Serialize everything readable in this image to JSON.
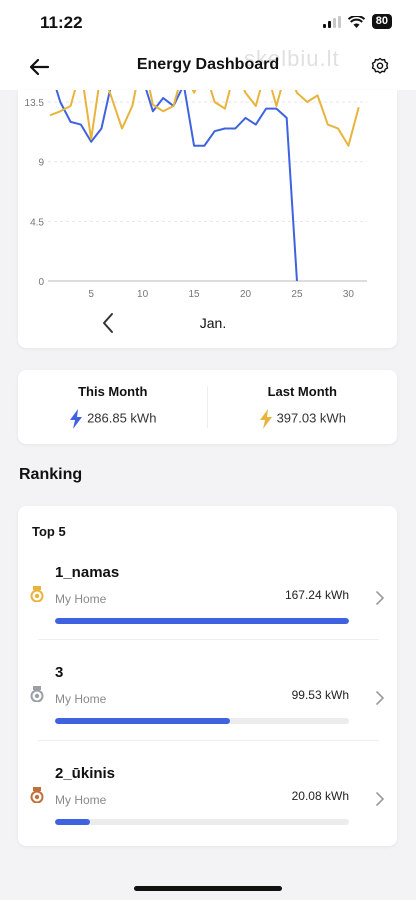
{
  "status": {
    "time": "11:22",
    "battery": "80"
  },
  "header": {
    "title": "Energy Dashboard",
    "watermark": "skelbiu.lt"
  },
  "chart_data": {
    "type": "line",
    "x": [
      1,
      2,
      3,
      4,
      5,
      6,
      7,
      8,
      9,
      10,
      11,
      12,
      13,
      14,
      15,
      16,
      17,
      18,
      19,
      20,
      21,
      22,
      23,
      24,
      25,
      26,
      27,
      28,
      29,
      30,
      31
    ],
    "series": [
      {
        "color": "#3f63e0",
        "values": [
          16,
          13.5,
          12,
          11.8,
          10.5,
          11.5,
          15,
          16,
          15.5,
          15.3,
          12.8,
          13.8,
          13.2,
          14.8,
          10.2,
          10.2,
          11.3,
          11.5,
          11.5,
          12.3,
          11.8,
          13,
          13,
          12.3,
          0
        ]
      },
      {
        "color": "#e8b43c",
        "values": [
          12.5,
          12.8,
          13.2,
          16,
          10.7,
          16,
          13.8,
          11.5,
          13.2,
          17,
          13.3,
          12.8,
          13.2,
          16,
          14.2,
          16,
          13.5,
          13,
          16,
          14.2,
          13.2,
          16,
          13.2,
          16,
          14.2,
          13.5,
          14,
          11.8,
          11.5,
          10.2,
          13.1
        ]
      }
    ],
    "ylim": [
      0,
      15
    ],
    "yticks": [
      "0",
      "4.5",
      "9",
      "13.5"
    ],
    "xticks": [
      "5",
      "10",
      "15",
      "20",
      "25",
      "30"
    ],
    "month": "Jan."
  },
  "stats": {
    "this_month": {
      "label": "This Month",
      "value": "286.85 kWh",
      "color": "#3f63e0"
    },
    "last_month": {
      "label": "Last Month",
      "value": "397.03 kWh",
      "color": "#e8b43c"
    }
  },
  "ranking": {
    "title": "Ranking",
    "top_label": "Top 5",
    "items": [
      {
        "name": "1_namas",
        "home": "My Home",
        "value": "167.24 kWh",
        "fraction": 1.0,
        "medal_color": "#e8b43c"
      },
      {
        "name": "3",
        "home": "My Home",
        "value": "99.53 kWh",
        "fraction": 0.595,
        "medal_color": "#9aa0a6"
      },
      {
        "name": "2_ūkinis",
        "home": "My Home",
        "value": "20.08 kWh",
        "fraction": 0.12,
        "medal_color": "#c0703c"
      }
    ]
  }
}
